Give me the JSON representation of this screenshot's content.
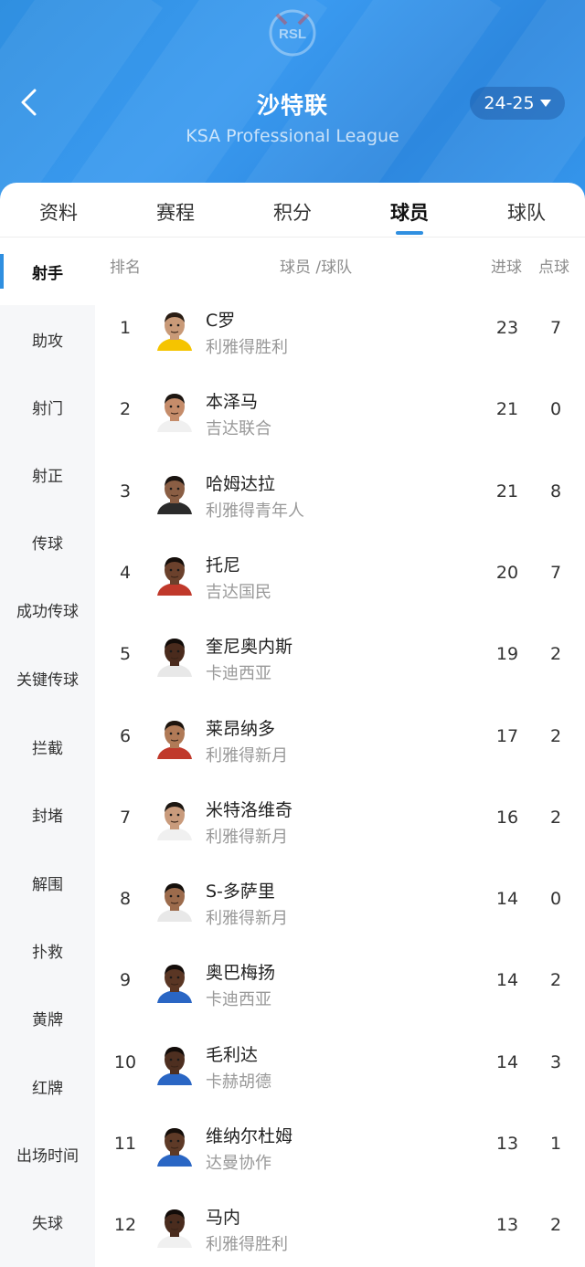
{
  "header": {
    "logo_text": "RSL",
    "title": "沙特联",
    "subtitle": "KSA Professional League",
    "season": "24-25"
  },
  "tabs": [
    {
      "label": "资料"
    },
    {
      "label": "赛程"
    },
    {
      "label": "积分"
    },
    {
      "label": "球员",
      "active": true
    },
    {
      "label": "球队"
    }
  ],
  "sidebar": [
    {
      "label": "射手",
      "active": true
    },
    {
      "label": "助攻"
    },
    {
      "label": "射门"
    },
    {
      "label": "射正"
    },
    {
      "label": "传球"
    },
    {
      "label": "成功传球"
    },
    {
      "label": "关键传球"
    },
    {
      "label": "拦截"
    },
    {
      "label": "封堵"
    },
    {
      "label": "解围"
    },
    {
      "label": "扑救"
    },
    {
      "label": "黄牌"
    },
    {
      "label": "红牌"
    },
    {
      "label": "出场时间"
    },
    {
      "label": "失球"
    }
  ],
  "columns": {
    "rank": "排名",
    "player_team": "球员 /球队",
    "goals": "进球",
    "penalties": "点球"
  },
  "players": [
    {
      "rank": "1",
      "name": "C罗",
      "team": "利雅得胜利",
      "goals": "23",
      "penalties": "7",
      "skin": "#c99a78",
      "hair": "#2a1d14",
      "shirt": "#f5c400"
    },
    {
      "rank": "2",
      "name": "本泽马",
      "team": "吉达联合",
      "goals": "21",
      "penalties": "0",
      "skin": "#c58c6a",
      "hair": "#1e1712",
      "shirt": "#f0f0f0"
    },
    {
      "rank": "3",
      "name": "哈姆达拉",
      "team": "利雅得青年人",
      "goals": "21",
      "penalties": "8",
      "skin": "#8a5e44",
      "hair": "#1a1410",
      "shirt": "#2b2b2b"
    },
    {
      "rank": "4",
      "name": "托尼",
      "team": "吉达国民",
      "goals": "20",
      "penalties": "7",
      "skin": "#6b412c",
      "hair": "#160f0b",
      "shirt": "#c0392b"
    },
    {
      "rank": "5",
      "name": "奎尼奥内斯",
      "team": "卡迪西亚",
      "goals": "19",
      "penalties": "2",
      "skin": "#4a2b1d",
      "hair": "#120c09",
      "shirt": "#e8e8e8"
    },
    {
      "rank": "6",
      "name": "莱昂纳多",
      "team": "利雅得新月",
      "goals": "17",
      "penalties": "2",
      "skin": "#b07a57",
      "hair": "#1d140e",
      "shirt": "#c0392b"
    },
    {
      "rank": "7",
      "name": "米特洛维奇",
      "team": "利雅得新月",
      "goals": "16",
      "penalties": "2",
      "skin": "#c99b7c",
      "hair": "#1d1712",
      "shirt": "#f0f0f0"
    },
    {
      "rank": "8",
      "name": "S-多萨里",
      "team": "利雅得新月",
      "goals": "14",
      "penalties": "0",
      "skin": "#9c6b4c",
      "hair": "#15100c",
      "shirt": "#e8e8e8"
    },
    {
      "rank": "9",
      "name": "奥巴梅扬",
      "team": "卡迪西亚",
      "goals": "14",
      "penalties": "2",
      "skin": "#5a3624",
      "hair": "#140d0a",
      "shirt": "#2a66c4"
    },
    {
      "rank": "10",
      "name": "毛利达",
      "team": "卡赫胡德",
      "goals": "14",
      "penalties": "3",
      "skin": "#4e2f20",
      "hair": "#120c09",
      "shirt": "#2a66c4"
    },
    {
      "rank": "11",
      "name": "维纳尔杜姆",
      "team": "达曼协作",
      "goals": "13",
      "penalties": "1",
      "skin": "#5e3a27",
      "hair": "#150e0a",
      "shirt": "#2a66c4"
    },
    {
      "rank": "12",
      "name": "马内",
      "team": "利雅得胜利",
      "goals": "13",
      "penalties": "2",
      "skin": "#4a2c1e",
      "hair": "#120c09",
      "shirt": "#f0f0f0"
    }
  ],
  "colors": {
    "accent": "#2f8fe0",
    "header_bg": "#3593ea",
    "sidebar_bg": "#f6f7f9",
    "muted_text": "#999999"
  }
}
